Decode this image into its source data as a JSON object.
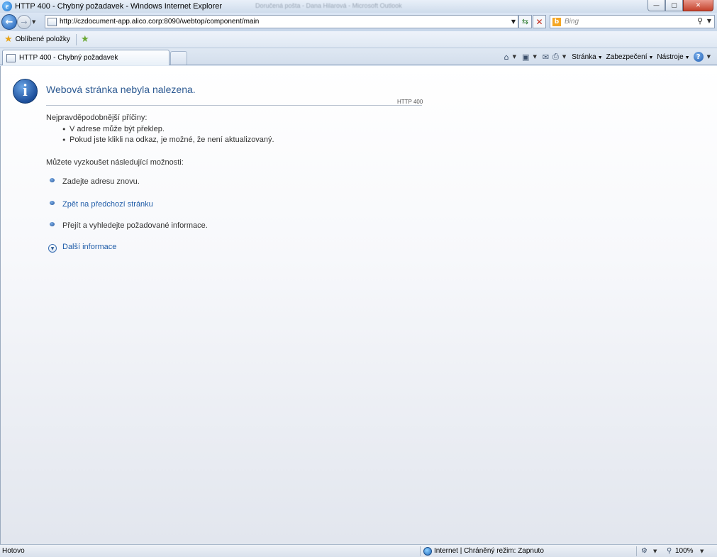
{
  "window": {
    "title": "HTTP 400 - Chybný požadavek - Windows Internet Explorer",
    "background_title": "Doručená pošta - Dana Hilarová - Microsoft Outlook",
    "controls": {
      "minimize": "—",
      "maximize": "▢",
      "close": "✕"
    }
  },
  "address_bar": {
    "url": "http://czdocument-app.alico.corp:8090/webtop/component/main",
    "search_placeholder": "Bing"
  },
  "favorites_bar": {
    "label": "Oblíbené položky"
  },
  "tabs": [
    {
      "label": "HTTP 400 - Chybný požadavek",
      "active": true
    }
  ],
  "command_bar": {
    "menus": [
      "Stránka",
      "Zabezpečení",
      "Nástroje"
    ]
  },
  "page": {
    "title": "Webová stránka nebyla nalezena.",
    "http_code": "HTTP 400",
    "causes_heading": "Nejpravděpodobnější příčiny:",
    "causes": [
      "V adrese může být překlep.",
      "Pokud jste klikli na odkaz, je možné, že není aktualizovaný."
    ],
    "options_heading": "Můžete vyzkoušet následující možnosti:",
    "options": [
      {
        "text": "Zadejte adresu znovu.",
        "is_link": false
      },
      {
        "text": "Zpět na předchozí stránku",
        "is_link": true
      },
      {
        "text": "Přejít  a vyhledejte požadované informace.",
        "is_link": false
      }
    ],
    "more_info": "Další informace"
  },
  "status_bar": {
    "status": "Hotovo",
    "zone": "Internet | Chráněný režim: Zapnuto",
    "zoom": "100%"
  },
  "colors": {
    "title_blue": "#2d5a92",
    "link_blue": "#1f5ca8",
    "chrome_blue": "#dbe6f4"
  }
}
